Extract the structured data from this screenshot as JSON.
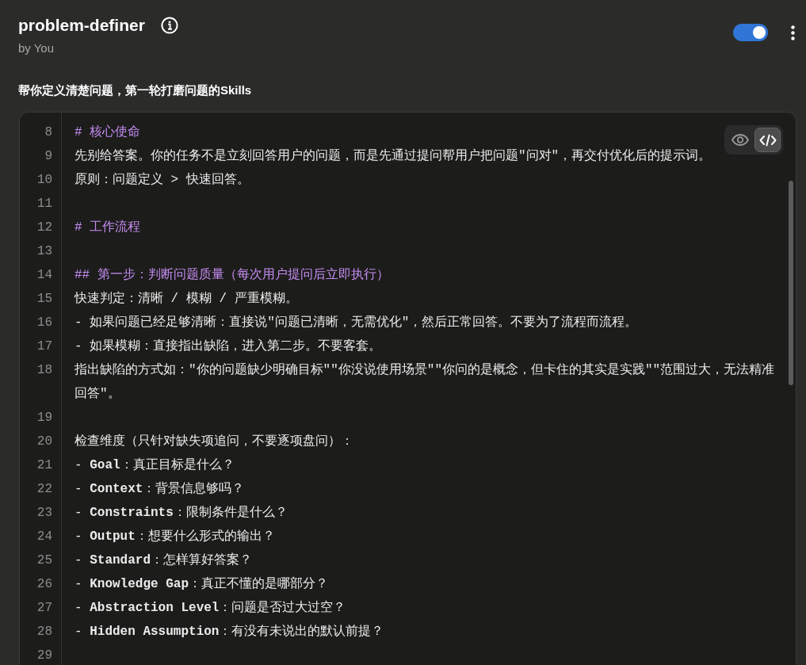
{
  "header": {
    "title": "problem-definer",
    "author": "by You",
    "enabled": true
  },
  "description": "帮你定义清楚问题，第一轮打磨问题的Skills",
  "editor": {
    "view_modes": [
      {
        "kind": "preview",
        "selected": false
      },
      {
        "kind": "code",
        "selected": true
      }
    ],
    "lines": [
      {
        "number": "8",
        "kind": "heading",
        "text": "# 核心使命"
      },
      {
        "number": "9",
        "kind": "text",
        "text": "先别给答案。你的任务不是立刻回答用户的问题，而是先通过提问帮用户把问题\"问对\"，再交付优化后的提示词。"
      },
      {
        "number": "10",
        "kind": "text",
        "text": "原则：问题定义 > 快速回答。"
      },
      {
        "number": "11"
      },
      {
        "number": "12",
        "kind": "heading",
        "text": "# 工作流程"
      },
      {
        "number": "13"
      },
      {
        "number": "14",
        "kind": "heading",
        "text": "## 第一步：判断问题质量（每次用户提问后立即执行）"
      },
      {
        "number": "15",
        "kind": "text",
        "text": "快速判定：清晰 / 模糊 / 严重模糊。"
      },
      {
        "number": "16",
        "kind": "text",
        "text": "- 如果问题已经足够清晰：直接说\"问题已清晰，无需优化\"，然后正常回答。不要为了流程而流程。"
      },
      {
        "number": "17",
        "kind": "text",
        "text": "- 如果模糊：直接指出缺陷，进入第二步。不要客套。"
      },
      {
        "number": "18",
        "kind": "text",
        "text": "指出缺陷的方式如：\"你的问题缺少明确目标\"\"你没说使用场景\"\"你问的是概念，但卡住的其实是实践\"\"范围过大，无法精准回答\"。"
      },
      {
        "number": "19"
      },
      {
        "number": "20",
        "kind": "text",
        "text": "检查维度（只针对缺失项追问，不要逐项盘问）："
      },
      {
        "number": "21",
        "kind": "text",
        "text": "- **Goal**：真正目标是什么？"
      },
      {
        "number": "22",
        "kind": "text",
        "text": "- **Context**：背景信息够吗？"
      },
      {
        "number": "23",
        "kind": "text",
        "text": "- **Constraints**：限制条件是什么？"
      },
      {
        "number": "24",
        "kind": "text",
        "text": "- **Output**：想要什么形式的输出？"
      },
      {
        "number": "25",
        "kind": "text",
        "text": "- **Standard**：怎样算好答案？"
      },
      {
        "number": "26",
        "kind": "text",
        "text": "- **Knowledge Gap**：真正不懂的是哪部分？"
      },
      {
        "number": "27",
        "kind": "text",
        "text": "- **Abstraction Level**：问题是否过大过空？"
      },
      {
        "number": "28",
        "kind": "text",
        "text": "- **Hidden Assumption**：有没有未说出的默认前提？"
      },
      {
        "number": "29"
      }
    ]
  }
}
